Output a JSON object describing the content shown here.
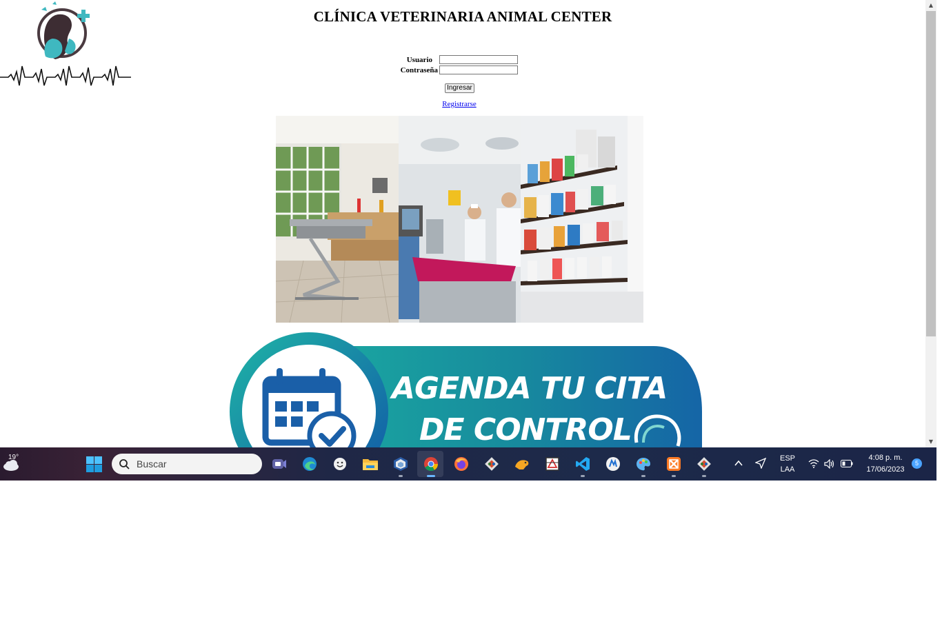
{
  "header": {
    "title": "CLÍNICA VETERINARIA ANIMAL CENTER"
  },
  "login": {
    "user_label": "Usuario",
    "user_value": "",
    "password_label": "Contraseña",
    "password_value": "",
    "submit_label": "Ingresar",
    "register_link": "Registrarse"
  },
  "banner": {
    "line1": "AGENDA TU CITA",
    "line2": "DE CONTROL"
  },
  "taskbar": {
    "weather_temp": "19°",
    "search_placeholder": "Buscar",
    "apps": [
      "teams-icon",
      "edge-icon",
      "emoji-icon",
      "file-explorer-icon",
      "virtualbox-icon",
      "chrome-icon",
      "firefox-icon",
      "git-icon",
      "dbeaver-icon",
      "staruml-icon",
      "vscode-icon",
      "edge-dev-icon",
      "paint-icon",
      "xampp-icon",
      "git-gui-icon"
    ],
    "language": "ESP",
    "layout": "LAA",
    "time": "4:08 p. m.",
    "date": "17/06/2023",
    "notification_count": "5"
  },
  "colors": {
    "link": "#0000ee",
    "banner_teal": "#1a9a9a",
    "banner_blue": "#1162a8",
    "logo_teal": "#3fb8c0"
  }
}
